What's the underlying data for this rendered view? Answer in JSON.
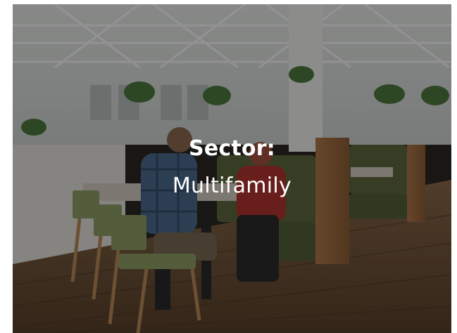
{
  "card": {
    "label": "Sector:",
    "value": "Multifamily"
  },
  "background_image": {
    "subject": "photo-of-lounge-with-booths"
  },
  "colors": {
    "caption_text": "#ffffff",
    "overlay": "#000000"
  }
}
